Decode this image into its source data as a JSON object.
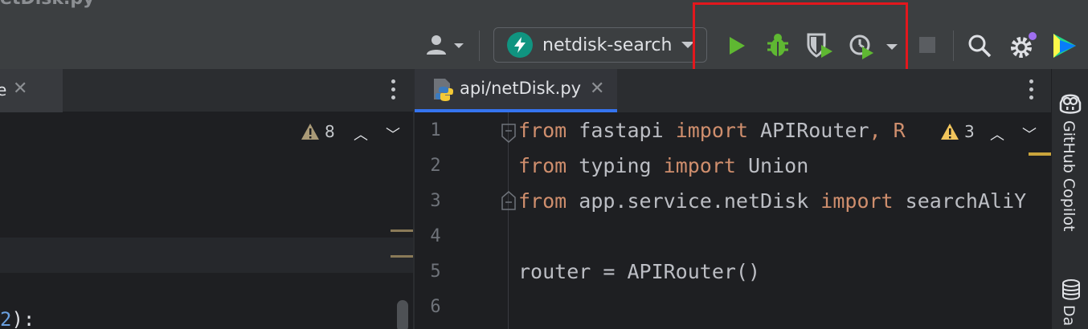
{
  "window": {
    "title": "etDisk.py"
  },
  "toolbar": {
    "profile_icon": "user-icon",
    "run_config": {
      "label": "netdisk-search",
      "icon": "lightning-icon",
      "icon_color": "#109480"
    },
    "run_icon": "play-icon",
    "debug_icon": "bug-icon",
    "coverage_icon": "shield-run-icon",
    "profiler_icon": "profile-run-icon",
    "stop_icon": "stop-icon",
    "search_icon": "search-icon",
    "settings_icon": "gear-icon",
    "plugin_icon": "toolbox-icon",
    "run_color": "#5fb832",
    "highlight_color": "#e3171d"
  },
  "left_pane": {
    "tab": {
      "label": "e"
    },
    "inspections": {
      "warnings": "8"
    },
    "visible_code": {
      "number": "2",
      "suffix": "):"
    }
  },
  "right_pane": {
    "tab": {
      "label": "api/netDisk.py",
      "accent": "#3574f0"
    },
    "inspections": {
      "warnings": "3"
    },
    "lines": [
      {
        "no": "1",
        "t1": "from",
        "t2": " fastapi ",
        "t3": "import",
        "t4": " APIRouter",
        "t5": ", R"
      },
      {
        "no": "2",
        "t1": "from",
        "t2": " typing ",
        "t3": "import",
        "t4": " Union",
        "t5": ""
      },
      {
        "no": "3",
        "t1": "from",
        "t2": " app.service.netDisk ",
        "t3": "import",
        "t4": " searchAliY",
        "t5": ""
      },
      {
        "no": "4",
        "t1": "",
        "t2": "",
        "t3": "",
        "t4": "",
        "t5": ""
      },
      {
        "no": "5",
        "t1": "",
        "t2": "router = APIRouter()",
        "t3": "",
        "t4": "",
        "t5": ""
      },
      {
        "no": "6",
        "t1": "",
        "t2": "",
        "t3": "",
        "t4": "",
        "t5": ""
      }
    ]
  },
  "side_panel": {
    "copilot_label": "GitHub Copilot",
    "db_label": "Da"
  }
}
